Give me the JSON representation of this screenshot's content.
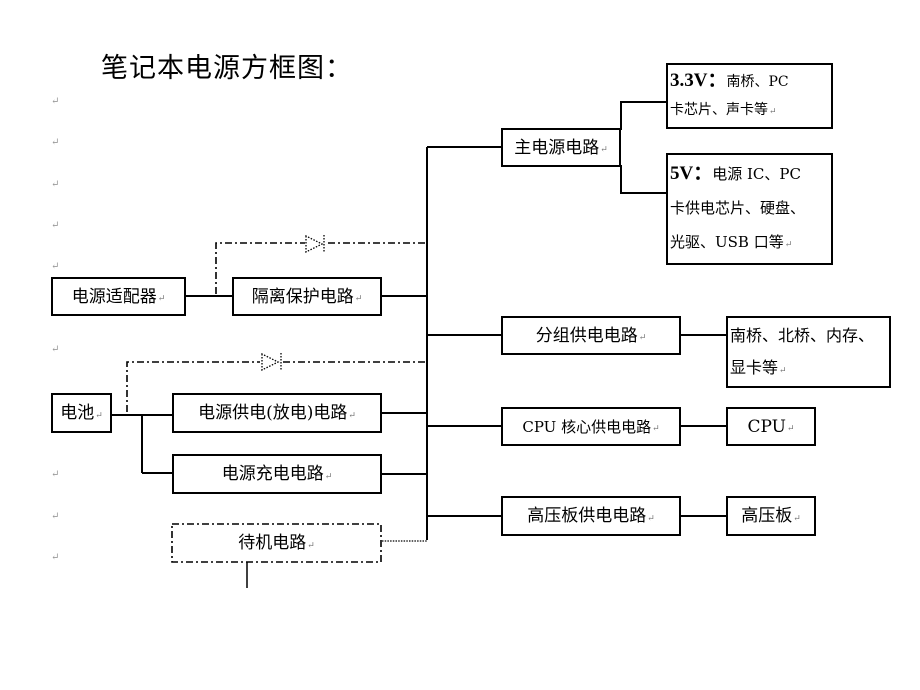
{
  "title": "笔记本电源方框图：",
  "paragraph_mark": "↵",
  "nodes": {
    "adapter": "电源适配器",
    "isolation": "隔离保护电路",
    "battery": "电池",
    "discharge": "电源供电(放电)电路",
    "charge": "电源充电电路",
    "standby": "待机电路",
    "main_power": "主电源电路",
    "group_power": "分组供电电路",
    "cpu_core": "CPU 核心供电电路",
    "hv_power": "高压板供电电路",
    "cpu": "CPU",
    "hv_board": "高压板",
    "group_targets": [
      "南桥、北桥、内存、",
      "显卡等"
    ],
    "rail_33v": {
      "label": "3.3V：",
      "lines": [
        "南桥、PC",
        "卡芯片、声卡等"
      ]
    },
    "rail_5v": {
      "label": "5V：",
      "lines": [
        "电源 IC、PC",
        "卡供电芯片、硬盘、",
        "光驱、USB 口等"
      ]
    }
  },
  "connections": [
    {
      "from": "电源适配器",
      "to": "隔离保护电路",
      "style": "solid"
    },
    {
      "from": "电源适配器",
      "to": "bus",
      "style": "dash-dot",
      "via": "diode"
    },
    {
      "from": "隔离保护电路",
      "to": "bus",
      "style": "solid"
    },
    {
      "from": "电池",
      "to": "电源供电(放电)电路",
      "style": "solid"
    },
    {
      "from": "电池",
      "to": "电源充电电路",
      "style": "solid"
    },
    {
      "from": "电池",
      "to": "bus",
      "style": "dash-dot",
      "via": "diode"
    },
    {
      "from": "电源供电(放电)电路",
      "to": "bus",
      "style": "solid"
    },
    {
      "from": "电源充电电路",
      "to": "bus",
      "style": "solid"
    },
    {
      "from": "待机电路",
      "to": "bus",
      "style": "dotted"
    },
    {
      "from": "bus",
      "to": "主电源电路",
      "style": "solid"
    },
    {
      "from": "bus",
      "to": "分组供电电路",
      "style": "solid"
    },
    {
      "from": "bus",
      "to": "CPU 核心供电电路",
      "style": "solid"
    },
    {
      "from": "bus",
      "to": "高压板供电电路",
      "style": "solid"
    },
    {
      "from": "主电源电路",
      "to": "3.3V",
      "style": "solid"
    },
    {
      "from": "主电源电路",
      "to": "5V",
      "style": "solid"
    },
    {
      "from": "分组供电电路",
      "to": "南桥、北桥、内存、显卡等",
      "style": "solid"
    },
    {
      "from": "CPU 核心供电电路",
      "to": "CPU",
      "style": "solid"
    },
    {
      "from": "高压板供电电路",
      "to": "高压板",
      "style": "solid"
    }
  ]
}
